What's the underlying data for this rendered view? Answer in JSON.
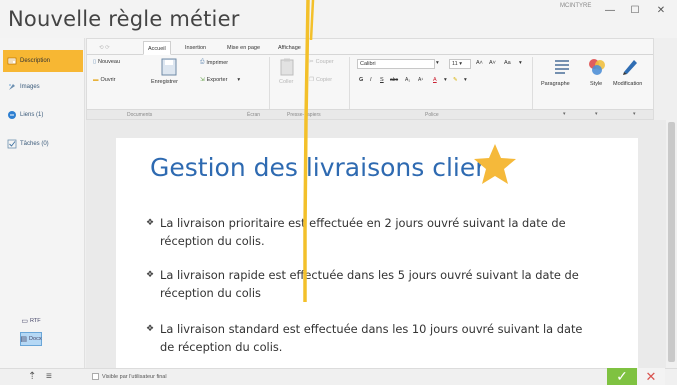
{
  "window": {
    "title": "Nouvelle règle métier",
    "user": "MCINTYRE",
    "min_icon": "minimize-icon",
    "max_icon": "maximize-icon",
    "close_icon": "close-icon"
  },
  "sidebar": {
    "items": [
      {
        "label": "Description",
        "icon": "description-icon",
        "active": true
      },
      {
        "label": "Images",
        "icon": "images-icon",
        "active": false
      },
      {
        "label": "Liens (1)",
        "icon": "links-icon",
        "active": false
      },
      {
        "label": "Tâches (0)",
        "icon": "tasks-icon",
        "active": false
      }
    ],
    "formats": [
      {
        "label": "RTF",
        "active": false
      },
      {
        "label": "Docx",
        "active": true
      }
    ]
  },
  "ribbon": {
    "tabs": [
      "Accueil",
      "Insertion",
      "Mise en page",
      "Affichage"
    ],
    "active_tab": "Accueil",
    "document": {
      "nouveau": "Nouveau",
      "ouvrir": "Ouvrir",
      "enregistrer": "Enregistrer",
      "imprimer": "Imprimer",
      "exporter": "Exporter"
    },
    "clipboard": {
      "coller": "Coller",
      "couper": "Couper",
      "copier": "Copier"
    },
    "font": {
      "name": "Calibri",
      "size": "11",
      "grow": "A˄",
      "shrink": "A˅",
      "case": "Aa",
      "bold": "G",
      "italic": "I",
      "underline": "S"
    },
    "big": {
      "paragraphe": "Paragraphe",
      "style": "Style",
      "modification": "Modification"
    },
    "groups": {
      "documents": "Documents",
      "ecran": "Écran",
      "presse_papiers": "Presse-papiers",
      "police": "Police"
    }
  },
  "document": {
    "heading": "Gestion des livraisons client",
    "bullets": [
      {
        "line1": "La livraison prioritaire est effectuée en 2 jours ouvré suivant la date de",
        "line2": "réception du colis."
      },
      {
        "line1": "La livraison rapide est effectuée dans les 5 jours ouvré suivant la date de",
        "line2": "réception du colis"
      },
      {
        "line1": "La livraison standard est effectuée dans les 10 jours ouvré suivant la date",
        "line2": "de réception du colis."
      }
    ],
    "bullet_marker": "❖"
  },
  "statusbar": {
    "visible_label": "Visible par l'utilisateur final",
    "ok_icon": "check-icon",
    "cancel_icon": "cross-icon"
  },
  "colors": {
    "accent": "#f7b733",
    "heading": "#2e6ab1",
    "ok": "#7fc241",
    "cancel": "#d9534f",
    "star": "#f5b93a"
  }
}
